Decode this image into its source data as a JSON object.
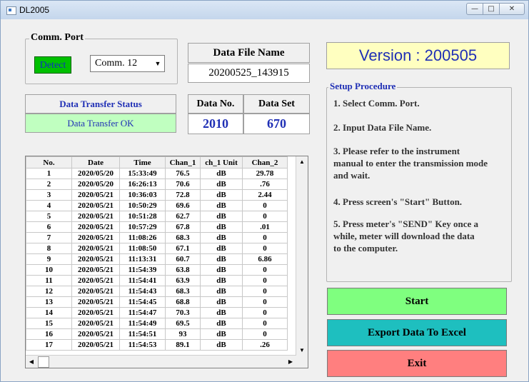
{
  "window": {
    "title": "DL2005",
    "controls": {
      "minimize": "—",
      "maximize": "□",
      "close": "✕"
    }
  },
  "comm_port": {
    "group_label": "Comm. Port",
    "detect_label": "Detect",
    "selected_port": "Comm. 12"
  },
  "data_file": {
    "label": "Data File Name",
    "value": "20200525_143915"
  },
  "version": {
    "label": "Version : 200505"
  },
  "transfer": {
    "status_label": "Data Transfer Status",
    "status_value": "Data Transfer OK"
  },
  "data_no": {
    "label": "Data No.",
    "value": "2010"
  },
  "data_set": {
    "label": "Data Set",
    "value": "670"
  },
  "setup": {
    "group_label": "Setup Procedure",
    "steps": [
      "1. Select Comm. Port.",
      "2. Input Data File Name.",
      "3. Please refer to the instrument manual to enter the transmission mode and wait.",
      "4. Press screen's \"Start\" Button.",
      "5. Press meter's \"SEND\" Key once a while, meter will download the data to the computer."
    ]
  },
  "buttons": {
    "start": "Start",
    "export": "Export Data To Excel",
    "exit": "Exit"
  },
  "colors": {
    "start_bg": "#7fff7f",
    "export_bg": "#1ebfbf",
    "exit_bg": "#ff7f7f",
    "value_blue": "#1f2fb5",
    "status_bg": "#c0ffc0",
    "version_bg": "#ffffc0"
  },
  "table": {
    "columns": [
      "No.",
      "Date",
      "Time",
      "Chan_1",
      "ch_1 Unit",
      "Chan_2"
    ],
    "rows": [
      [
        "1",
        "2020/05/20",
        "15:33:49",
        "76.5",
        "dB",
        "29.78"
      ],
      [
        "2",
        "2020/05/20",
        "16:26:13",
        "70.6",
        "dB",
        ".76"
      ],
      [
        "3",
        "2020/05/21",
        "10:36:03",
        "72.8",
        "dB",
        "2.44"
      ],
      [
        "4",
        "2020/05/21",
        "10:50:29",
        "69.6",
        "dB",
        "0"
      ],
      [
        "5",
        "2020/05/21",
        "10:51:28",
        "62.7",
        "dB",
        "0"
      ],
      [
        "6",
        "2020/05/21",
        "10:57:29",
        "67.8",
        "dB",
        ".01"
      ],
      [
        "7",
        "2020/05/21",
        "11:08:26",
        "68.3",
        "dB",
        "0"
      ],
      [
        "8",
        "2020/05/21",
        "11:08:50",
        "67.1",
        "dB",
        "0"
      ],
      [
        "9",
        "2020/05/21",
        "11:13:31",
        "60.7",
        "dB",
        "6.86"
      ],
      [
        "10",
        "2020/05/21",
        "11:54:39",
        "63.8",
        "dB",
        "0"
      ],
      [
        "11",
        "2020/05/21",
        "11:54:41",
        "63.9",
        "dB",
        "0"
      ],
      [
        "12",
        "2020/05/21",
        "11:54:43",
        "68.3",
        "dB",
        "0"
      ],
      [
        "13",
        "2020/05/21",
        "11:54:45",
        "68.8",
        "dB",
        "0"
      ],
      [
        "14",
        "2020/05/21",
        "11:54:47",
        "70.3",
        "dB",
        "0"
      ],
      [
        "15",
        "2020/05/21",
        "11:54:49",
        "69.5",
        "dB",
        "0"
      ],
      [
        "16",
        "2020/05/21",
        "11:54:51",
        "93",
        "dB",
        "0"
      ],
      [
        "17",
        "2020/05/21",
        "11:54:53",
        "89.1",
        "dB",
        ".26"
      ]
    ]
  }
}
